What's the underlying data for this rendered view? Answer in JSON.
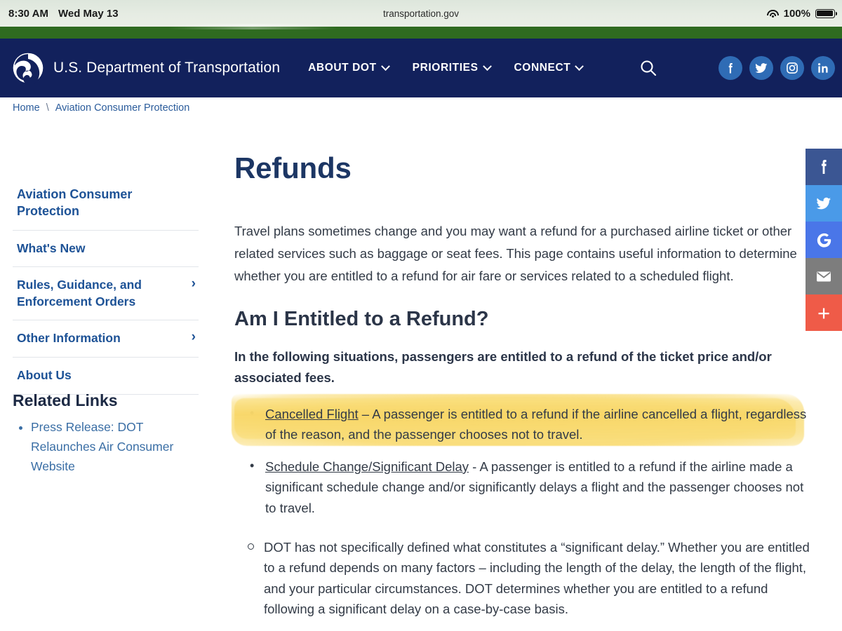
{
  "status_bar": {
    "time": "8:30 AM",
    "date": "Wed May 13",
    "url": "transportation.gov",
    "battery_percent": "100%",
    "wifi_icon": "wifi-icon",
    "battery_icon": "battery-icon"
  },
  "header": {
    "logo_icon": "dot-triskelion-logo",
    "brand": "U.S. Department of Transportation",
    "nav": [
      {
        "label": "ABOUT DOT",
        "has_caret": true
      },
      {
        "label": "PRIORITIES",
        "has_caret": true
      },
      {
        "label": "CONNECT",
        "has_caret": true
      }
    ],
    "search_icon": "search-icon",
    "social": [
      {
        "name": "facebook-icon"
      },
      {
        "name": "twitter-icon"
      },
      {
        "name": "instagram-icon"
      },
      {
        "name": "linkedin-icon"
      }
    ],
    "colors": {
      "navy": "#12215c",
      "green": "#2f6b20",
      "social_circle": "#2f6cb5"
    }
  },
  "breadcrumb": {
    "home": "Home",
    "separator": "\\",
    "current": "Aviation Consumer Protection"
  },
  "sidebar": {
    "items": [
      {
        "label": "Aviation Consumer Protection",
        "chevron": ""
      },
      {
        "label": "What's New",
        "chevron": ""
      },
      {
        "label": "Rules, Guidance, and Enforcement Orders",
        "chevron": "›"
      },
      {
        "label": "Other Information",
        "chevron": "›"
      },
      {
        "label": "About Us",
        "chevron": ""
      }
    ],
    "related": {
      "title": "Related Links",
      "links": [
        "Press Release: DOT Relaunches Air Consumer Website"
      ]
    }
  },
  "main": {
    "title": "Refunds",
    "intro": "Travel plans sometimes change and you may want a refund for a purchased airline ticket or other related services such as baggage or seat fees.  This page contains useful information to determine whether you are entitled to a refund for air fare or services related to a scheduled flight.",
    "section_title": "Am I Entitled to a Refund?",
    "lede": "In the following situations, passengers are entitled to a refund of the ticket price and/or associated fees.",
    "bullets": [
      {
        "link_text": "Cancelled Flight",
        "body": " – A passenger is entitled to a refund if the airline cancelled a flight, regardless of the reason, and the passenger chooses not to travel.",
        "highlighted": true,
        "highlight_color": "#f9db72"
      },
      {
        "link_text": "Schedule Change/Significant Delay",
        "body": " - A passenger is entitled to a refund if the airline made a significant schedule change and/or significantly delays a flight and the passenger chooses not to travel.",
        "highlighted": false
      }
    ],
    "sub_bullets": [
      "DOT has not specifically defined what constitutes a “significant delay.”  Whether you are entitled to a refund depends on many factors – including the length of the delay, the length of the flight, and your particular circumstances.  DOT determines whether you are entitled to a refund following a significant delay on a case-by-case basis."
    ]
  },
  "share_rail": {
    "buttons": [
      {
        "name": "share-facebook",
        "color": "#3b5693"
      },
      {
        "name": "share-twitter",
        "color": "#4a9ae8"
      },
      {
        "name": "share-google",
        "color": "#4a76e8"
      },
      {
        "name": "share-email",
        "color": "#7d7d7d"
      },
      {
        "name": "share-more",
        "color": "#ef5b48",
        "label": "+"
      }
    ]
  }
}
